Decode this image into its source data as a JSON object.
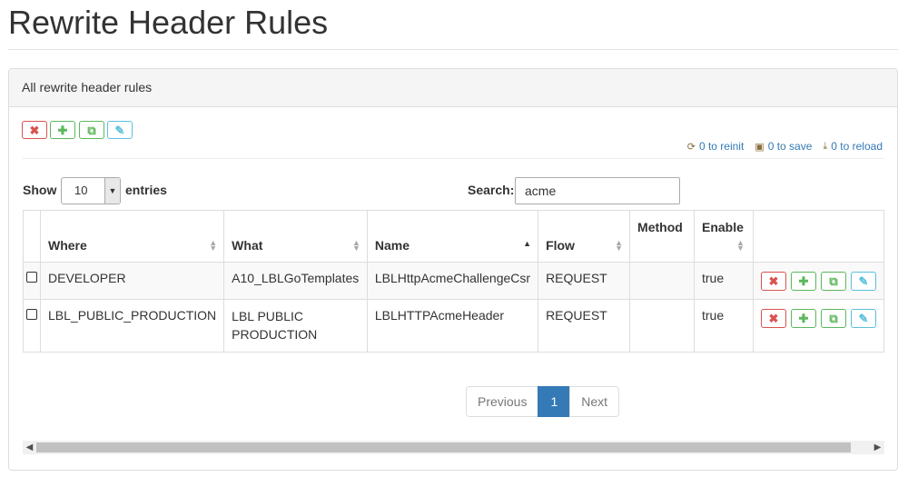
{
  "page": {
    "title": "Rewrite Header Rules"
  },
  "panel": {
    "heading": "All rewrite header rules",
    "toolbar": {
      "delete_icon": "✖",
      "add_icon": "✚",
      "copy_icon": "⧉",
      "edit_icon": "✎"
    },
    "status": {
      "reinit": "0 to reinit",
      "save": "0 to save",
      "reload": "0 to reload"
    }
  },
  "length_menu": {
    "show": "Show",
    "value": "10",
    "entries": "entries"
  },
  "search": {
    "label": "Search:",
    "value": "acme"
  },
  "table": {
    "headers": {
      "where": "Where",
      "what": "What",
      "name": "Name",
      "flow": "Flow",
      "method": "Method",
      "enable": "Enable"
    },
    "rows": [
      {
        "where": "DEVELOPER",
        "what": "A10_LBLGoTemplates",
        "name": "LBLHttpAcmeChallengeCsr",
        "flow": "REQUEST",
        "method": "",
        "enable": "true"
      },
      {
        "where": "LBL_PUBLIC_PRODUCTION",
        "what": "LBL PUBLIC PRODUCTION",
        "name": "LBLHTTPAcmeHeader",
        "flow": "REQUEST",
        "method": "",
        "enable": "true"
      }
    ]
  },
  "pagination": {
    "previous": "Previous",
    "current": "1",
    "next": "Next"
  },
  "colors": {
    "danger": "#d9534f",
    "success": "#5cb85c",
    "info": "#5bc0de",
    "primary": "#337ab7"
  }
}
